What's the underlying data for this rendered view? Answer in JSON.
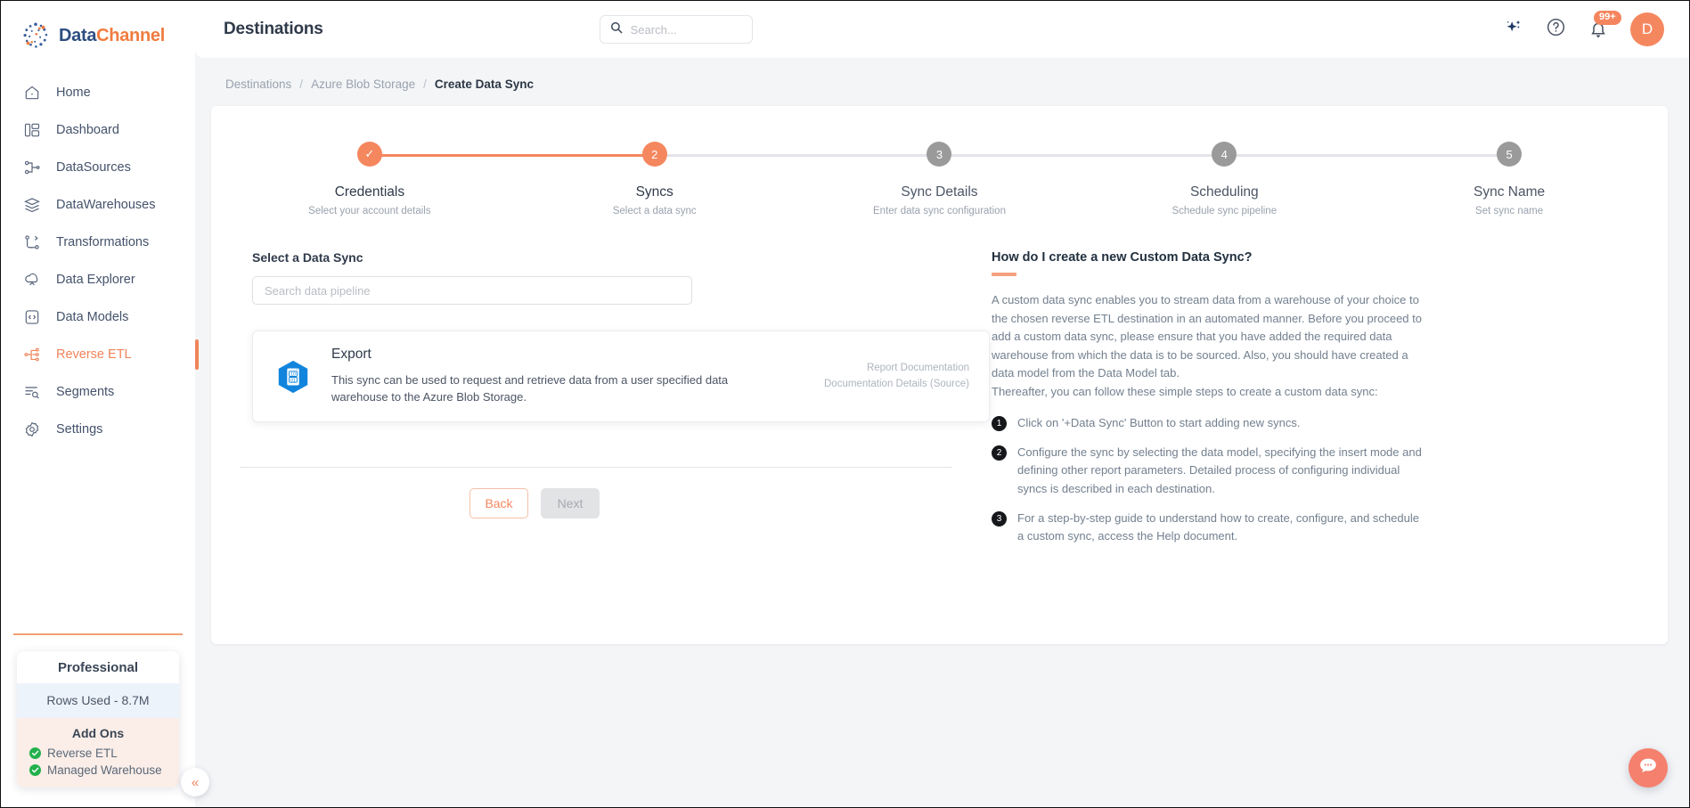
{
  "brand": {
    "name_part1": "Data",
    "name_part2": "Channel",
    "logo_icon": "datachannel-logo-icon"
  },
  "sidebar": {
    "items": [
      {
        "label": "Home",
        "icon": "home-icon"
      },
      {
        "label": "Dashboard",
        "icon": "dashboard-icon"
      },
      {
        "label": "DataSources",
        "icon": "datasources-icon"
      },
      {
        "label": "DataWarehouses",
        "icon": "datawarehouses-icon"
      },
      {
        "label": "Transformations",
        "icon": "transformations-icon"
      },
      {
        "label": "Data Explorer",
        "icon": "data-explorer-icon"
      },
      {
        "label": "Data Models",
        "icon": "data-models-icon"
      },
      {
        "label": "Reverse ETL",
        "icon": "reverse-etl-icon"
      },
      {
        "label": "Segments",
        "icon": "segments-icon"
      },
      {
        "label": "Settings",
        "icon": "settings-icon"
      }
    ],
    "plan": {
      "title": "Professional",
      "rows_used": "Rows Used - 8.7M",
      "addons_title": "Add Ons",
      "addons": [
        {
          "label": "Reverse ETL"
        },
        {
          "label": "Managed Warehouse"
        }
      ]
    },
    "collapse_label": "«"
  },
  "header": {
    "title": "Destinations",
    "search": {
      "placeholder": "Search...",
      "value": "",
      "icon": "search-icon"
    },
    "ai_icon": "sparkle-ai-icon",
    "help_icon": "help-circle-icon",
    "notifications": {
      "icon": "bell-icon",
      "badge": "99+"
    },
    "avatar": {
      "initial": "D"
    }
  },
  "breadcrumb": {
    "items": [
      {
        "label": "Destinations",
        "current": false
      },
      {
        "label": "Azure Blob Storage",
        "current": false
      },
      {
        "label": "Create Data Sync",
        "current": true
      }
    ],
    "separator": "/"
  },
  "stepper": {
    "steps": [
      {
        "num": "1",
        "display": "✓",
        "name": "Credentials",
        "sub": "Select your account details",
        "state": "done"
      },
      {
        "num": "2",
        "display": "2",
        "name": "Syncs",
        "sub": "Select a data sync",
        "state": "current"
      },
      {
        "num": "3",
        "display": "3",
        "name": "Sync Details",
        "sub": "Enter data sync configuration",
        "state": "todo"
      },
      {
        "num": "4",
        "display": "4",
        "name": "Scheduling",
        "sub": "Schedule sync pipeline",
        "state": "todo"
      },
      {
        "num": "5",
        "display": "5",
        "name": "Sync Name",
        "sub": "Set sync name",
        "state": "todo"
      }
    ]
  },
  "form": {
    "section_label": "Select a Data Sync",
    "pipeline_search": {
      "placeholder": "Search data pipeline",
      "value": ""
    },
    "sync_card": {
      "icon": "azure-export-binary-icon",
      "title": "Export",
      "description": "This sync can be used to request and retrieve data from a user specified data warehouse to the Azure Blob Storage.",
      "links": [
        {
          "label": "Report Documentation"
        },
        {
          "label": "Documentation Details (Source)"
        }
      ]
    },
    "buttons": {
      "back": "Back",
      "next": "Next"
    }
  },
  "help": {
    "title": "How do I create a new Custom Data Sync?",
    "paragraph": "A custom data sync enables you to stream data from a warehouse of your choice to the chosen reverse ETL destination in an automated manner. Before you proceed to add a custom data sync, please ensure that you have added the required data warehouse from which the data is to be sourced. Also, you should have created a data model from the Data Model tab.",
    "paragraph2": "Thereafter, you can follow these simple steps to create a custom data sync:",
    "steps": [
      {
        "num": "1",
        "text": "Click on '+Data Sync' Button to start adding new syncs."
      },
      {
        "num": "2",
        "text": "Configure the sync by selecting the data model, specifying the insert mode and defining other report parameters. Detailed process of configuring individual syncs is described in each destination."
      },
      {
        "num": "3",
        "text": "For a step-by-step guide to understand how to create, configure, and schedule a custom sync, access the Help document."
      }
    ]
  },
  "chat": {
    "icon": "chat-bubble-icon"
  },
  "colors": {
    "accent": "#f5875f",
    "brand_blue": "#2d4d80",
    "azure_blue": "#1185dd",
    "muted": "#9aa2ae",
    "success_green": "#22b14c"
  }
}
